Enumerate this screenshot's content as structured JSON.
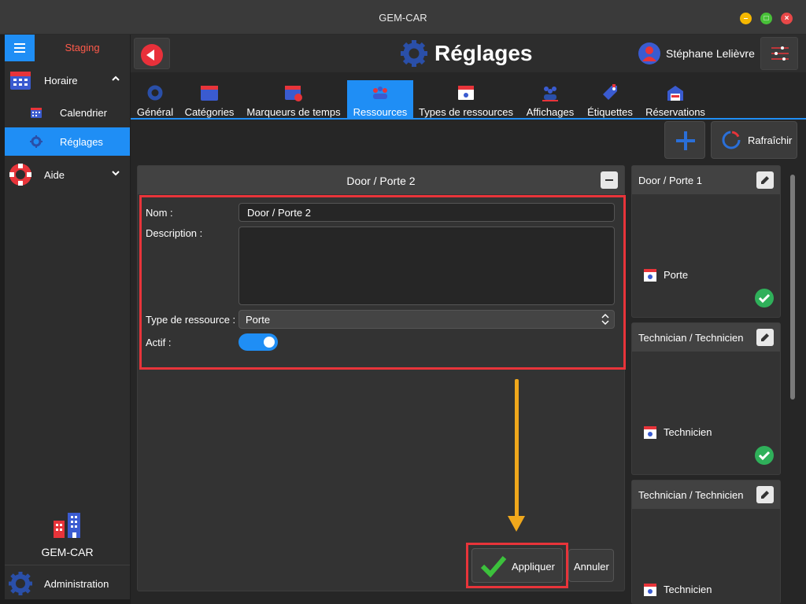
{
  "window": {
    "title": "GEM-CAR"
  },
  "sidebar": {
    "environment": "Staging",
    "items": [
      {
        "label": "Horaire"
      },
      {
        "label": "Calendrier"
      },
      {
        "label": "Réglages"
      },
      {
        "label": "Aide"
      }
    ],
    "brand": "GEM-CAR",
    "footer": {
      "label": "Administration"
    }
  },
  "header": {
    "title": "Réglages",
    "user": "Stéphane Lelièvre"
  },
  "tabs": [
    {
      "label": "Général"
    },
    {
      "label": "Catégories"
    },
    {
      "label": "Marqueurs de temps"
    },
    {
      "label": "Ressources"
    },
    {
      "label": "Types de ressources"
    },
    {
      "label": "Affichages"
    },
    {
      "label": "Étiquettes"
    },
    {
      "label": "Réservations"
    }
  ],
  "toolbar": {
    "refresh_label": "Rafraîchir"
  },
  "editor": {
    "title": "Door / Porte 2",
    "fields": {
      "name_label": "Nom :",
      "name_value": "Door / Porte 2",
      "description_label": "Description :",
      "description_value": "",
      "type_label": "Type de ressource :",
      "type_value": "Porte",
      "active_label": "Actif :",
      "active_value": true
    },
    "apply_label": "Appliquer",
    "cancel_label": "Annuler"
  },
  "resources": [
    {
      "title": "Door / Porte 1",
      "type": "Porte",
      "active": true
    },
    {
      "title": "Technician / Technicien",
      "type": "Technicien",
      "active": true
    },
    {
      "title": "Technician / Technicien",
      "type": "Technicien",
      "active": null
    }
  ],
  "colors": {
    "accent": "#1f8ef5",
    "highlight": "#e8343a",
    "arrow": "#f0a81c",
    "success": "#2fb05a",
    "staging": "#ff5a4a"
  }
}
